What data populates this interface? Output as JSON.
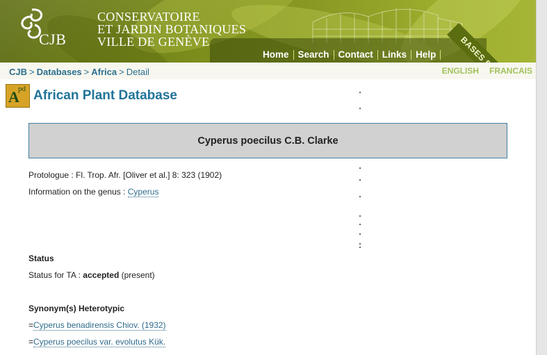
{
  "header": {
    "logo_text": "CJB",
    "org_lines": [
      "CONSERVATOIRE",
      "ET JARDIN BOTANIQUES",
      "VILLE DE GENÈVE"
    ],
    "nav": [
      "Home",
      "Search",
      "Contact",
      "Links",
      "Help"
    ],
    "corner_label": "BASES DE DONNÉES"
  },
  "breadcrumb": {
    "items": [
      "CJB",
      "Databases",
      "Africa"
    ],
    "separator": ">",
    "current": "Detail"
  },
  "languages": [
    "ENGLISH",
    "FRANCAIS"
  ],
  "database": {
    "icon_letters": [
      "A",
      "pd"
    ],
    "title": "African Plant Database"
  },
  "taxon": {
    "name": "Cyperus poecilus C.B. Clarke",
    "protologue": "Protologue : Fl. Trop. Afr. [Oliver et al.] 8: 323 (1902)",
    "genus_label": "Information on the genus : ",
    "genus_link": "Cyperus"
  },
  "status": {
    "heading": "Status",
    "label": "Status for TA : ",
    "value": "accepted",
    "note": " (present)"
  },
  "synonyms": {
    "heading": "Synonym(s) Heterotypic",
    "items": [
      {
        "prefix": "=",
        "name": "Cyperus benadirensis Chiov. (1932)"
      },
      {
        "prefix": "=",
        "name": "Cyperus poecilus var. evolutus Kük."
      }
    ]
  },
  "colors": {
    "banner_green": "#7b8c1c",
    "link_blue": "#2d6f8e",
    "title_blue": "#22749a",
    "lang_green": "#a3c15c",
    "species_box": "#d1d1d1"
  }
}
